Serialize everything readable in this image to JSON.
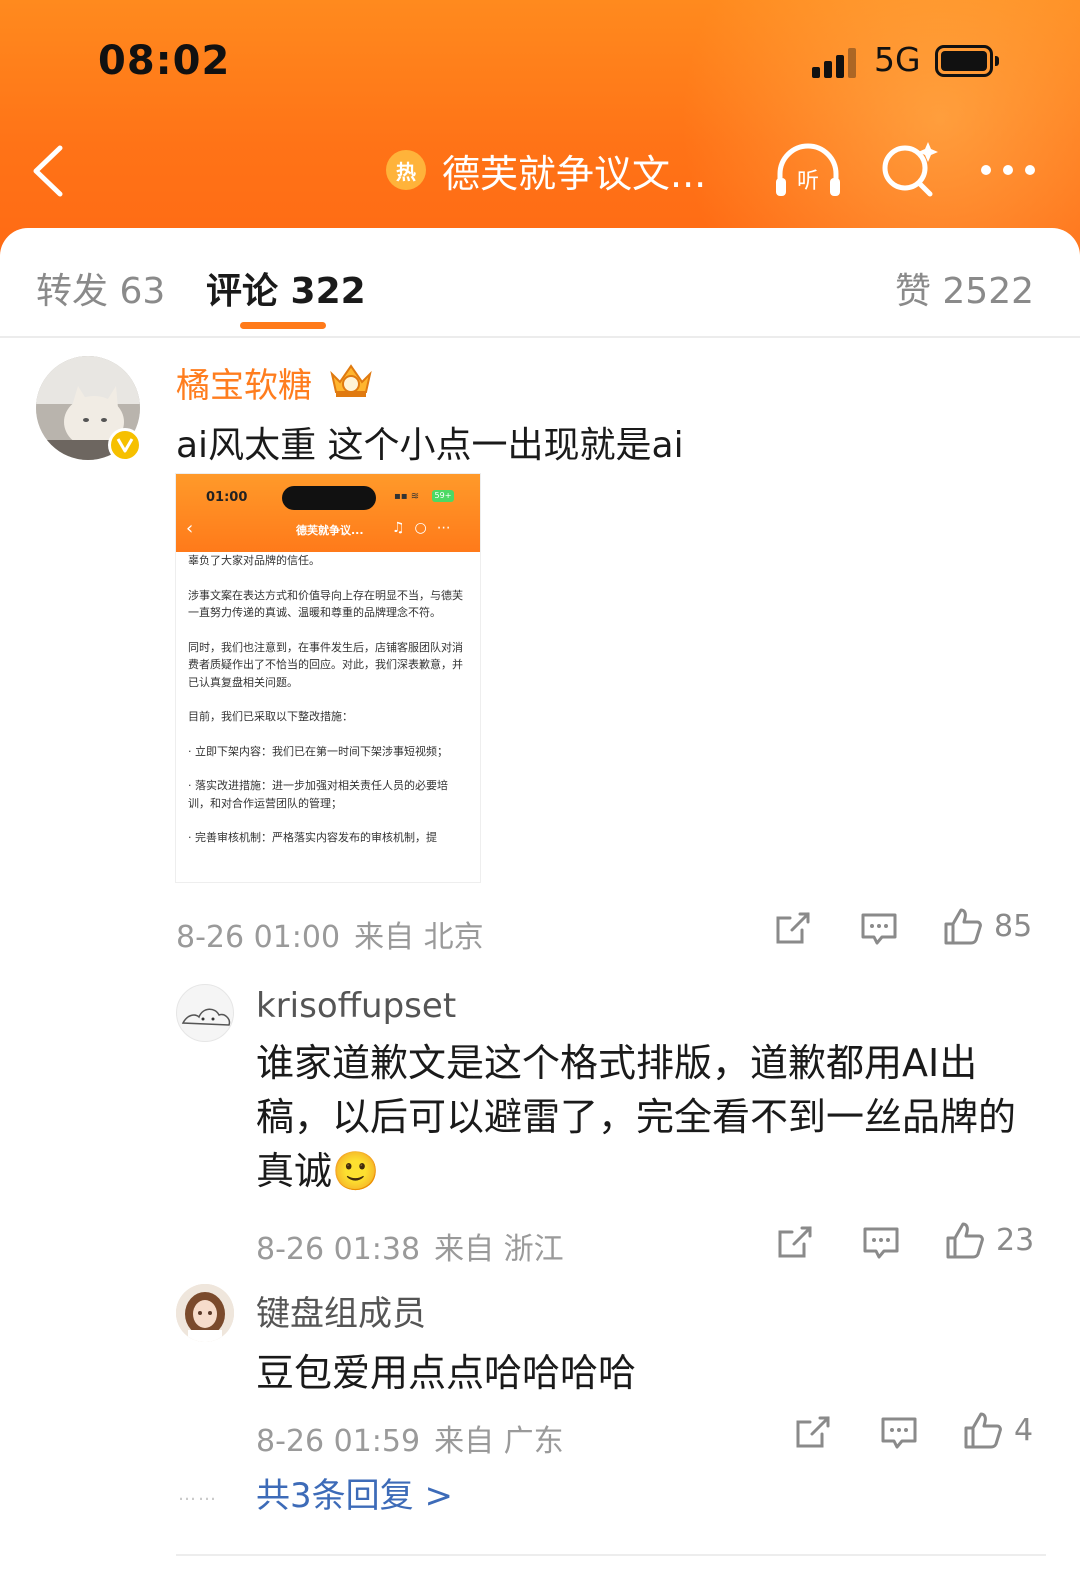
{
  "status_bar": {
    "time": "08:02",
    "network": "5G"
  },
  "header": {
    "hot_badge": "热",
    "title": "德芙就争议文...",
    "listen_label": "听",
    "icons": {
      "back": "chevron-left-icon",
      "listen": "headphones-icon",
      "search": "search-sparkle-icon",
      "more": "more-dots-icon"
    }
  },
  "tabs": {
    "repost": "转发 63",
    "comments": "评论 322",
    "likes": "赞 2522"
  },
  "comment": {
    "username": "橘宝软糖",
    "username_color": "#ff7d1e",
    "text": "ai风太重 这个小点一出现就是ai",
    "time": "8-26 01:00",
    "location": "来自 北京",
    "like_count": "85",
    "screenshot": {
      "time": "01:00",
      "battery": "59+",
      "title": "德芙就争议...",
      "paragraphs": [
        "辜负了大家对品牌的信任。",
        "涉事文案在表达方式和价值导向上存在明显不当，与德芙一直努力传递的真诚、温暖和尊重的品牌理念不符。",
        "同时，我们也注意到，在事件发生后，店铺客服团队对消费者质疑作出了不恰当的回应。对此，我们深表歉意，并已认真复盘相关问题。",
        "目前，我们已采取以下整改措施：",
        "· 立即下架内容：我们已在第一时间下架涉事短视频；",
        "· 落实改进措施：进一步加强对相关责任人员的必要培训，和对合作运营团队的管理；",
        "· 完善审核机制：严格落实内容发布的审核机制，提"
      ]
    }
  },
  "replies": [
    {
      "username": "krisoffupset",
      "text": "谁家道歉文是这个格式排版，道歉都用AI出稿，以后可以避雷了，完全看不到一丝品牌的真诚🙂",
      "time": "8-26 01:38",
      "location": "来自 浙江",
      "like_count": "23"
    },
    {
      "username": "键盘组成员",
      "text": "豆包爱用点点哈哈哈哈",
      "time": "8-26 01:59",
      "location": "来自 广东",
      "like_count": "4"
    }
  ],
  "reply_link": "共3条回复 >",
  "colors": {
    "brand_orange": "#ff7317",
    "link_blue": "#3d6bb8",
    "verified_gold": "#f6c000"
  }
}
